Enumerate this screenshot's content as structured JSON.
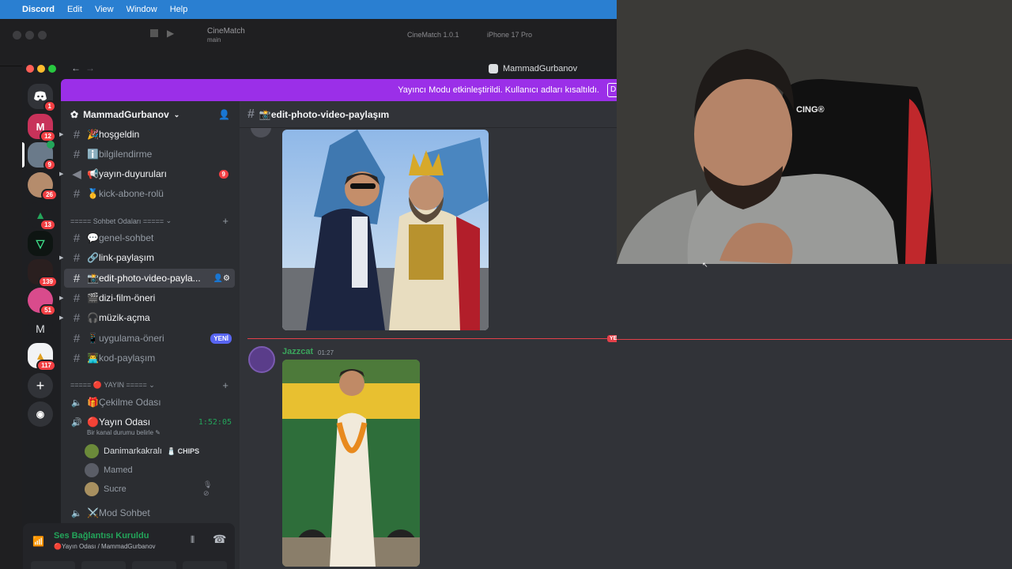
{
  "menubar": {
    "app": "Discord",
    "items": [
      "Edit",
      "View",
      "Window",
      "Help"
    ]
  },
  "xcode": {
    "project": "CineMatch",
    "branch": "main",
    "scheme": "CineMatch 1.0.1",
    "device": "iPhone 17 Pro"
  },
  "window": {
    "title": "MammadGurbanov"
  },
  "banner": {
    "text": "Yayıncı Modu etkinleştirildi. Kullanıcı adları kısaltıldı.",
    "button": "D"
  },
  "servers": [
    {
      "badge": "1"
    },
    {
      "badge": "12"
    },
    {
      "badge": "9"
    },
    {
      "badge": "26"
    },
    {
      "badge": "13"
    },
    {
      "badge": ""
    },
    {
      "badge": "139"
    },
    {
      "badge": "51"
    },
    {
      "letter": "M",
      "badge": ""
    },
    {
      "badge": "117"
    }
  ],
  "server": {
    "name": "MammadGurbanov"
  },
  "channels": [
    {
      "name": "🎉hoşgeldin"
    },
    {
      "name": "ℹ️bilgilendirme"
    },
    {
      "name": "📢yayın-duyuruları",
      "badge": "9"
    },
    {
      "name": "🥇kick-abone-rolü"
    }
  ],
  "category1": "===== Sohbet Odaları =====",
  "channels2": [
    {
      "name": "💬genel-sohbet"
    },
    {
      "name": "🔗link-paylaşım"
    },
    {
      "name": "📸edit-photo-video-payla..."
    },
    {
      "name": "🎬dizi-film-öneri"
    },
    {
      "name": "🎧müzik-açma"
    },
    {
      "name": "📱uygulama-öneri",
      "badge": "YENİ"
    },
    {
      "name": "👨‍💻kod-paylaşım"
    }
  ],
  "category2": "===== 🔴 YAYIN =====",
  "voice_channels": {
    "cekilme": "🎁Çekilme Odası",
    "yayin": "🔴Yayın Odası",
    "yayin_time": "1:52:05",
    "status_hint": "Bir kanal durumu belirle",
    "users": [
      {
        "name": "Danimarkakralı",
        "tag": "🧂 CHIPS"
      },
      {
        "name": "Mamed"
      },
      {
        "name": "Sucre"
      }
    ],
    "mod": "⚔️Mod Sohbet"
  },
  "voice_panel": {
    "status": "Ses Bağlantısı Kuruldu",
    "location": "🔴Yayın Odası / MammadGurbanov"
  },
  "chat": {
    "channel": "📸edit-photo-video-paylaşım",
    "message": {
      "author": "Jazzcat",
      "time": "01:27"
    },
    "new_marker": "YE"
  },
  "colors": {
    "accent": "#5865f2",
    "banner": "#9b2fe8",
    "danger": "#f23f43",
    "online": "#23a55a"
  }
}
